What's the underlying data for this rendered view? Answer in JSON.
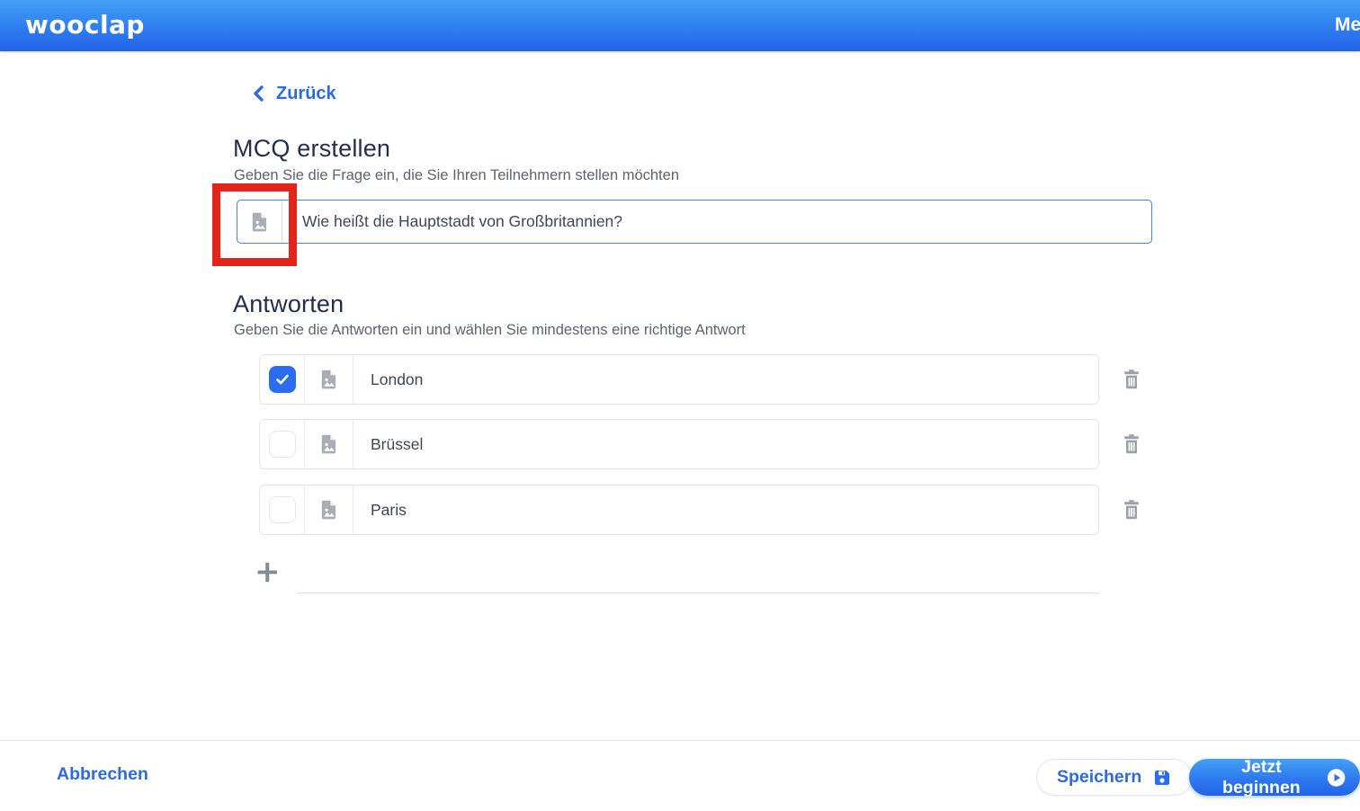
{
  "header": {
    "logo": "wooclap",
    "menu_fragment": "Me"
  },
  "back": {
    "label": "Zurück"
  },
  "question_section": {
    "title": "MCQ erstellen",
    "subtitle": "Geben Sie die Frage ein, die Sie Ihren Teilnehmern stellen möchten",
    "value": "Wie heißt die Hauptstadt von Großbritannien?"
  },
  "answers_section": {
    "title": "Antworten",
    "subtitle": "Geben Sie die Antworten ein und wählen Sie mindestens eine richtige Antwort",
    "items": [
      {
        "text": "London",
        "correct": true
      },
      {
        "text": "Brüssel",
        "correct": false
      },
      {
        "text": "Paris",
        "correct": false
      }
    ],
    "add_label": "+"
  },
  "footer": {
    "cancel_label": "Abbrechen",
    "save_label": "Speichern",
    "start_label": "Jetzt beginnen"
  },
  "icons": {
    "back_chevron": "‹",
    "attach_image": "image-file",
    "checkmark": "✓",
    "trash": "🗑",
    "plus": "+",
    "save": "💾",
    "play": "▶"
  },
  "colors": {
    "accent_blue": "#2b6df0",
    "link_blue": "#2d6ae0",
    "header_gradient_top": "#41a0f6",
    "header_gradient_bottom": "#2361e8",
    "annotation_red": "#e2241a",
    "icon_gray": "#a9aeb6",
    "text_dark": "#222f4e",
    "text_muted": "#5b6472"
  }
}
